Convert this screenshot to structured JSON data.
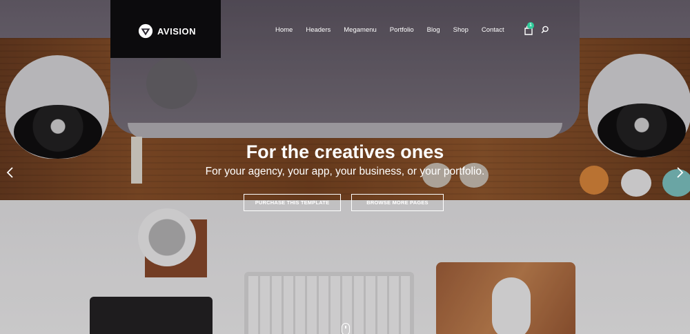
{
  "brand": {
    "name": "AVISION",
    "logo_icon": "shield-triangle-icon"
  },
  "nav": {
    "items": [
      {
        "label": "Home"
      },
      {
        "label": "Headers"
      },
      {
        "label": "Megamenu"
      },
      {
        "label": "Portfolio"
      },
      {
        "label": "Blog"
      },
      {
        "label": "Shop"
      },
      {
        "label": "Contact"
      }
    ],
    "cart_count": "1",
    "cart_icon": "shopping-bag-icon",
    "search_icon": "search-icon"
  },
  "hero": {
    "title": "For the creatives ones",
    "subtitle": "For your agency, your app, your business, or your portfolio.",
    "primary_button": "Purchase this template",
    "secondary_button": "Browse more pages",
    "prev_icon": "chevron-left-icon",
    "next_icon": "chevron-right-icon",
    "scroll_icon": "mouse-scroll-icon"
  },
  "colors": {
    "badge": "#2ecc9a",
    "text": "#ffffff"
  }
}
